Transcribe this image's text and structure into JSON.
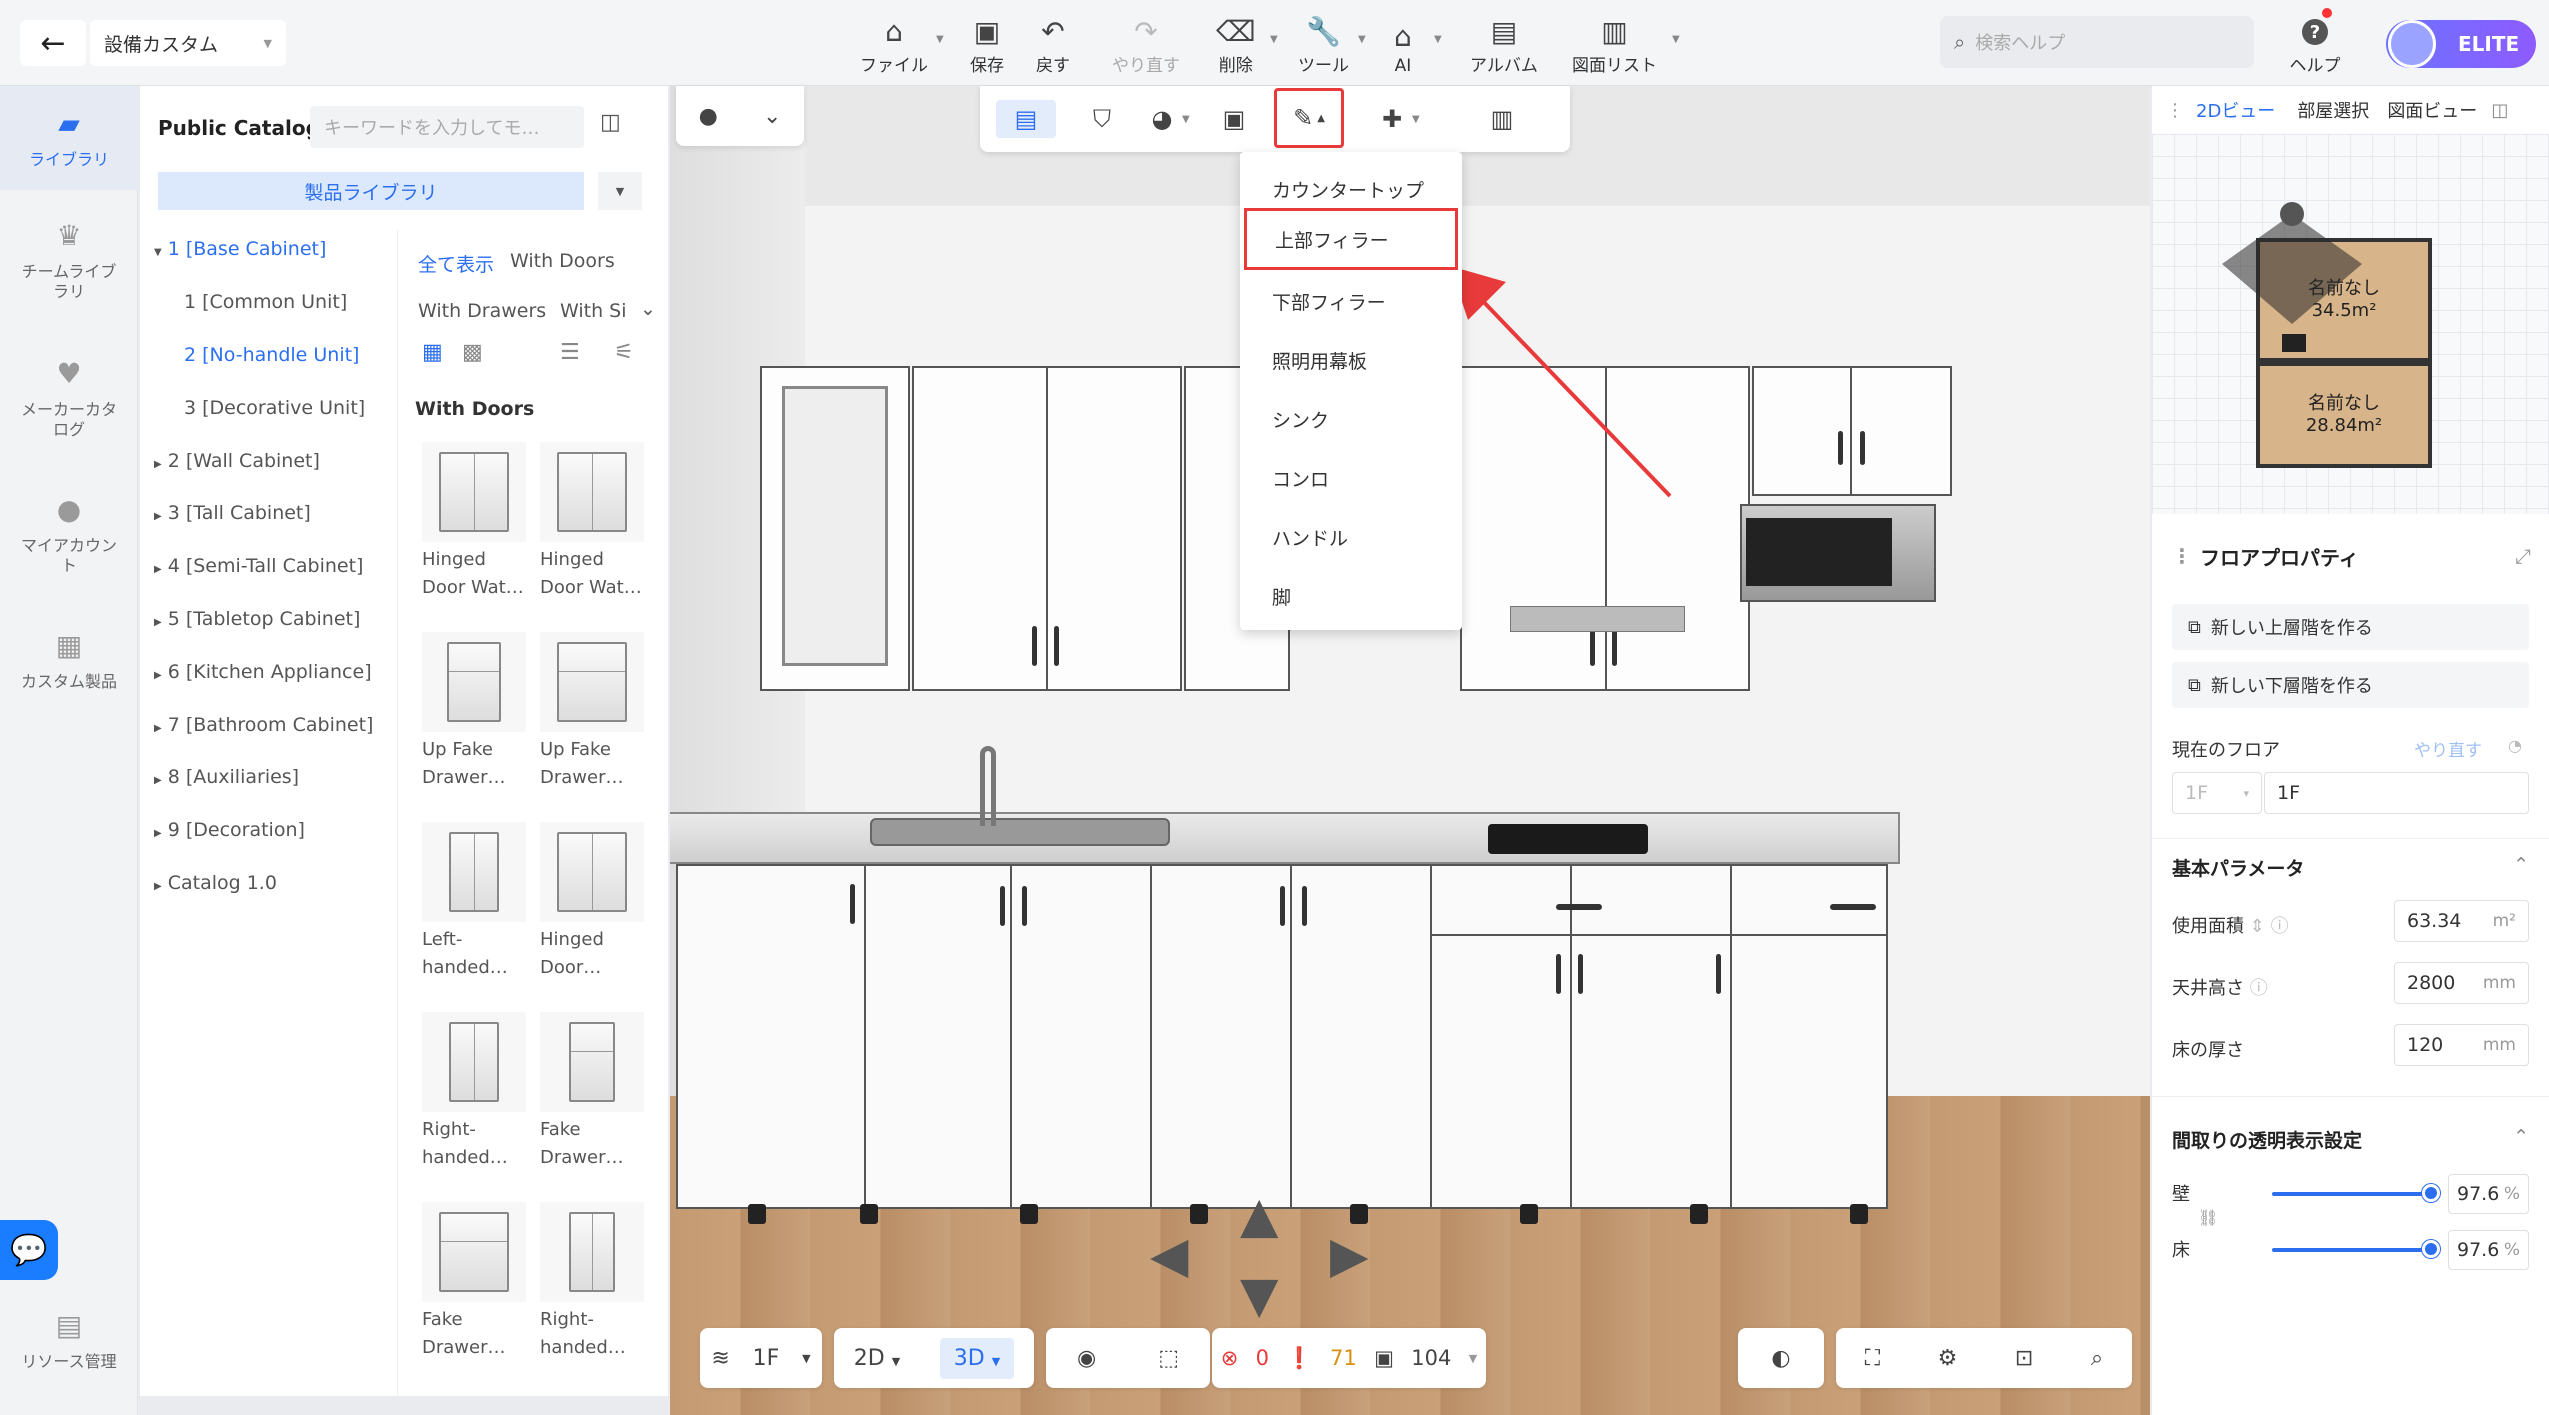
{
  "header": {
    "project_name": "設備カスタム",
    "toolbar": [
      {
        "label": "ファイル",
        "icon": "file-icon"
      },
      {
        "label": "保存",
        "icon": "save-icon"
      },
      {
        "label": "戻す",
        "icon": "undo-icon"
      },
      {
        "label": "やり直す",
        "icon": "redo-icon"
      },
      {
        "label": "削除",
        "icon": "eraser-icon"
      },
      {
        "label": "ツール",
        "icon": "wrench-icon"
      },
      {
        "label": "AI",
        "icon": "ai-house-icon"
      },
      {
        "label": "アルバム",
        "icon": "album-icon"
      },
      {
        "label": "図面リスト",
        "icon": "drawing-list-icon"
      }
    ],
    "search_placeholder": "検索ヘルプ",
    "help_label": "ヘルプ",
    "badge": "ELITE"
  },
  "left_nav": {
    "items": [
      {
        "label": "ライブラリ",
        "icon": "library-icon",
        "active": true
      },
      {
        "label": "チームライブラリ",
        "icon": "team-library-icon"
      },
      {
        "label": "メーカーカタログ",
        "icon": "maker-catalog-icon"
      },
      {
        "label": "マイアカウント",
        "icon": "account-icon"
      },
      {
        "label": "カスタム製品",
        "icon": "custom-product-icon"
      }
    ],
    "resource_label": "リソース管理"
  },
  "catalog": {
    "title": "Public Catalog",
    "search_placeholder": "キーワードを入力してモ…",
    "library_label": "製品ライブラリ",
    "tree": [
      {
        "label": "1 [Base Cabinet]",
        "selected": true,
        "expanded": true
      },
      {
        "label": "1 [Common Unit]",
        "child": true
      },
      {
        "label": "2 [No-handle Unit]",
        "child": true,
        "selected": true
      },
      {
        "label": "3 [Decorative Unit]",
        "child": true
      },
      {
        "label": "2 [Wall Cabinet]"
      },
      {
        "label": "3 [Tall Cabinet]"
      },
      {
        "label": "4 [Semi-Tall Cabinet]"
      },
      {
        "label": "5 [Tabletop Cabinet]"
      },
      {
        "label": "6 [Kitchen Appliance]"
      },
      {
        "label": "7 [Bathroom Cabinet]"
      },
      {
        "label": "8 [Auxiliaries]"
      },
      {
        "label": "9 [Decoration]"
      },
      {
        "label": "Catalog 1.0"
      }
    ],
    "filters": {
      "show_all": "全て表示",
      "with_doors": "With Doors",
      "with_drawers": "With Drawers",
      "with_si": "With Si"
    },
    "section_title": "With Doors",
    "products": [
      {
        "line1": "Hinged",
        "line2": "Door Wat…"
      },
      {
        "line1": "Hinged",
        "line2": "Door Wat…"
      },
      {
        "line1": "Up Fake",
        "line2": "Drawer…"
      },
      {
        "line1": "Up Fake",
        "line2": "Drawer…"
      },
      {
        "line1": "Left-",
        "line2": "handed…"
      },
      {
        "line1": "Hinged",
        "line2": "Door…"
      },
      {
        "line1": "Right-",
        "line2": "handed…"
      },
      {
        "line1": "Fake",
        "line2": "Drawer…"
      },
      {
        "line1": "Fake",
        "line2": "Drawer…"
      },
      {
        "line1": "Right-",
        "line2": "handed…"
      }
    ]
  },
  "dropdown_menu": {
    "items": [
      "カウンタートップ",
      "上部フィラー",
      "下部フィラー",
      "照明用幕板",
      "シンク",
      "コンロ",
      "ハンドル",
      "脚"
    ],
    "highlighted": "上部フィラー"
  },
  "bottom_bar": {
    "floor": "1F",
    "view_2d": "2D",
    "view_3d": "3D",
    "errors": "0",
    "warnings": "71",
    "items": "104"
  },
  "right_panel": {
    "tabs": [
      "2Dビュー",
      "部屋選択",
      "図面ビュー"
    ],
    "rooms": [
      {
        "name": "名前なし",
        "area": "34.5m²"
      },
      {
        "name": "名前なし",
        "area": "28.84m²"
      }
    ],
    "floor_props_title": "フロアプロパティ",
    "btn_new_upper": "新しい上層階を作る",
    "btn_new_lower": "新しい下層階を作る",
    "current_floor_label": "現在のフロア",
    "redo_label": "やり直す",
    "floor_select": "1F",
    "floor_name": "1F",
    "basic_params_title": "基本パラメータ",
    "area_label": "使用面積",
    "area_value": "63.34",
    "area_unit": "m²",
    "ceiling_label": "天井高さ",
    "ceiling_value": "2800",
    "floor_thick_label": "床の厚さ",
    "floor_thick_value": "120",
    "unit_mm": "mm",
    "transparency_title": "間取りの透明表示設定",
    "wall_label": "壁",
    "wall_value": "97.6",
    "floor_label": "床",
    "floor_value": "97.6",
    "percent": "%"
  },
  "colors": {
    "accent": "#2b6ff0",
    "highlight_red": "#e83a3a"
  }
}
